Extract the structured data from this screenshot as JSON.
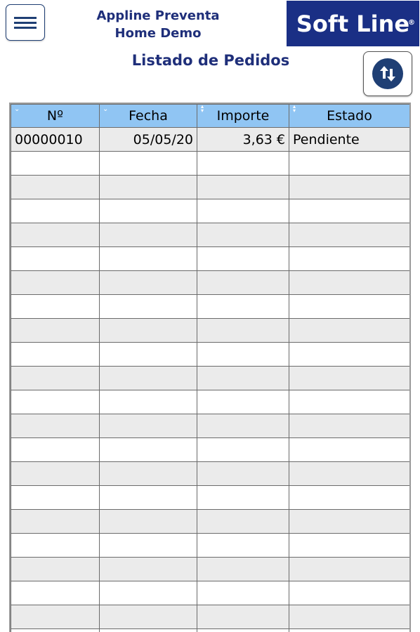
{
  "header": {
    "app_title_line1": "Appline Preventa",
    "app_title_line2": "Home Demo",
    "logo_text": "Soft Line",
    "logo_reg": "®",
    "page_title": "Listado de Pedidos"
  },
  "table": {
    "columns": [
      "Nº",
      "Fecha",
      "Importe",
      "Estado"
    ],
    "rows": [
      {
        "numero": "00000010",
        "fecha": "05/05/20",
        "importe": "3,63 €",
        "estado": "Pendiente"
      }
    ]
  },
  "colors": {
    "header_bg": "#90c5f3",
    "brand_navy": "#1a2f85",
    "row_alt": "#ebebeb"
  },
  "icons": {
    "menu": "hamburger-icon",
    "sort": "sort-arrows-icon"
  }
}
